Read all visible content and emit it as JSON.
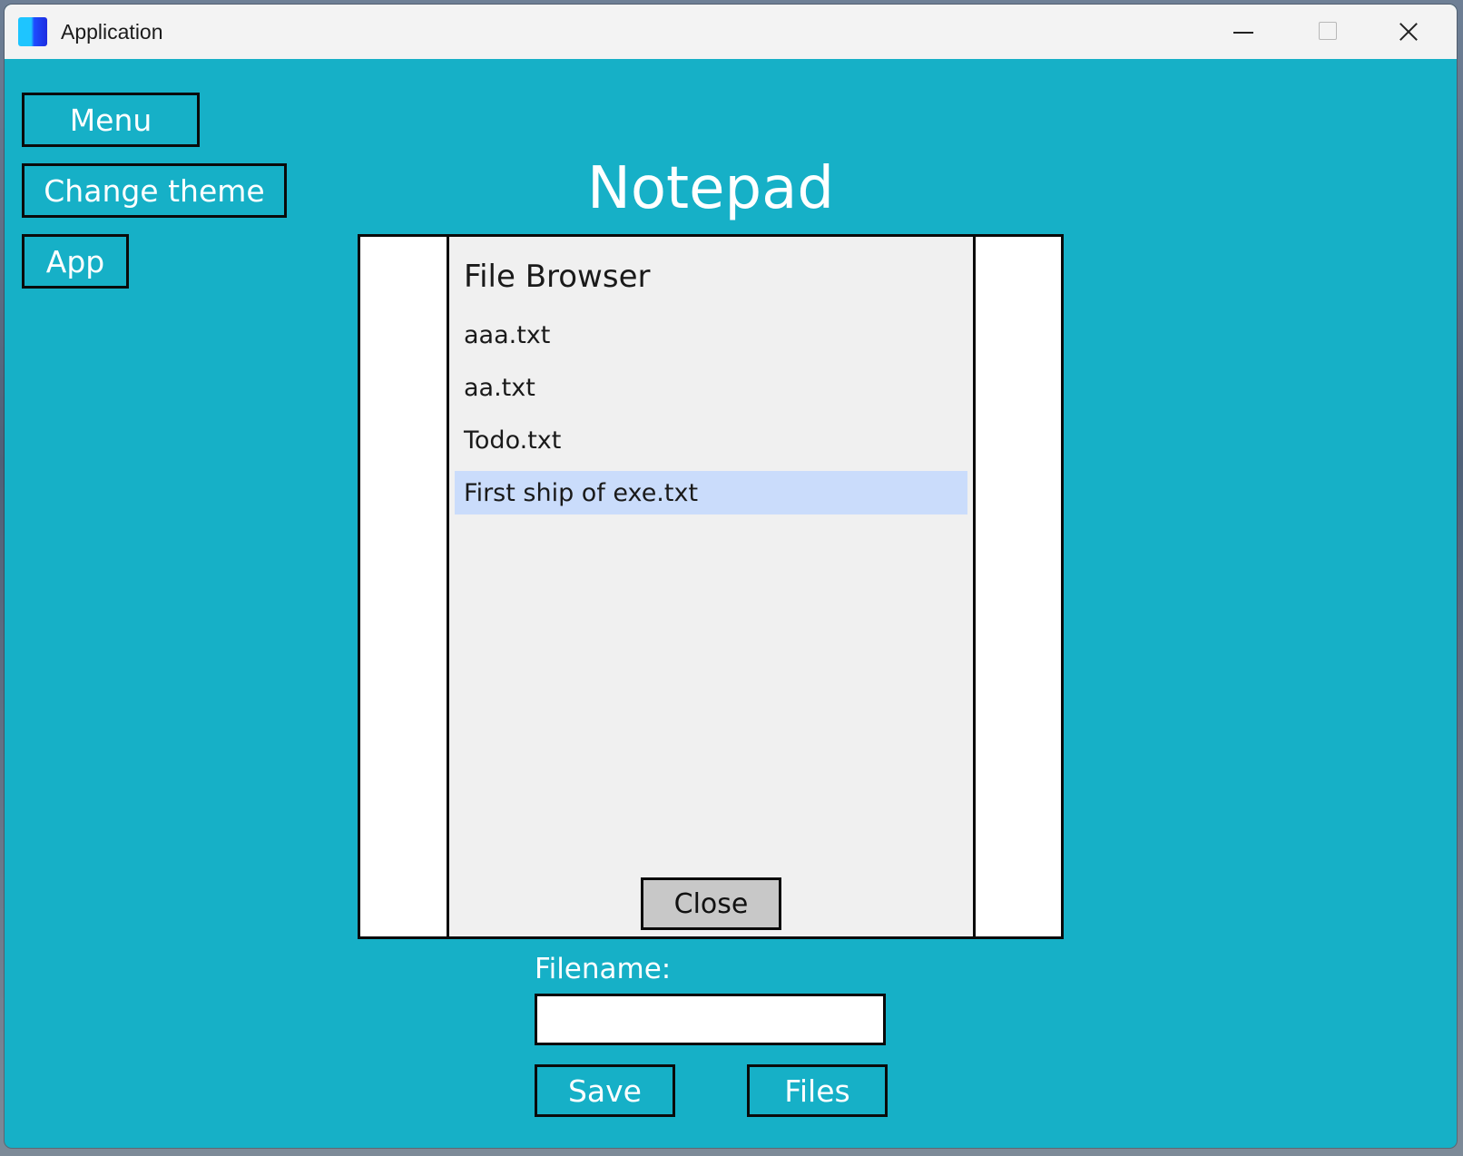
{
  "window": {
    "title": "Application",
    "controls": {
      "minimize": "minimize",
      "maximize": "maximize",
      "close": "close"
    }
  },
  "sidebar": {
    "menu_label": "Menu",
    "change_theme_label": "Change theme",
    "app_label": "App"
  },
  "main": {
    "title": "Notepad",
    "filename_label": "Filename:",
    "filename_value": "",
    "save_label": "Save",
    "files_label": "Files"
  },
  "file_browser": {
    "title": "File Browser",
    "files": [
      "aaa.txt",
      "aa.txt",
      "Todo.txt",
      "First ship of exe.txt"
    ],
    "selected_index": 3,
    "close_label": "Close"
  },
  "colors": {
    "background": "#16b0c7",
    "panel": "#f0f0f0",
    "selection": "#cadcfb",
    "border": "#0a0a0a",
    "button_text": "#ffffff"
  }
}
